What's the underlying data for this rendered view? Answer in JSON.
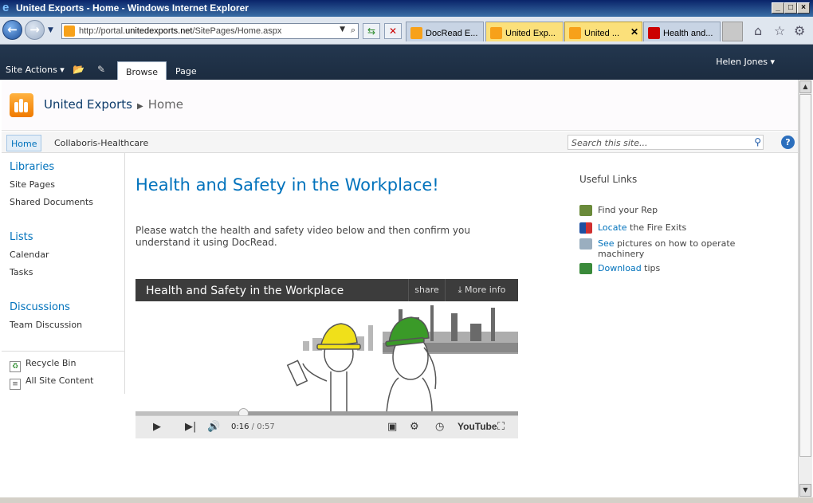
{
  "window": {
    "title": "United Exports - Home - Windows Internet Explorer"
  },
  "address": {
    "url_prefix": "http://portal.",
    "url_domain": "unitedexports.net",
    "url_path": "/SitePages/Home.aspx"
  },
  "tabs": [
    {
      "label": "DocRead E...",
      "color": "#f7a11a"
    },
    {
      "label": "United Exp...",
      "color": "#f7a11a"
    },
    {
      "label": "United ...",
      "color": "#f7a11a"
    },
    {
      "label": "Health and...",
      "color": "#cc0000"
    }
  ],
  "ribbon": {
    "site_actions": "Site Actions",
    "tab_browse": "Browse",
    "tab_page": "Page",
    "user": "Helen Jones"
  },
  "site": {
    "name": "United Exports",
    "page": "Home"
  },
  "topnav": {
    "home": "Home",
    "collaboris": "Collaboris-Healthcare",
    "search_placeholder": "Search this site...",
    "help": "?"
  },
  "leftnav": {
    "libraries": "Libraries",
    "site_pages": "Site Pages",
    "shared_documents": "Shared Documents",
    "lists": "Lists",
    "calendar": "Calendar",
    "tasks": "Tasks",
    "discussions": "Discussions",
    "team_discussion": "Team Discussion",
    "recycle_bin": "Recycle Bin",
    "all_site_content": "All Site Content"
  },
  "main": {
    "title": "Health and Safety in the Workplace!",
    "text": "Please watch the health and safety video below and then confirm you understand it using DocRead."
  },
  "video": {
    "title": "Health and Safety in the Workplace",
    "share": "share",
    "more_info": "More info",
    "current": "0:16",
    "duration": "0:57",
    "progress": 0.2807,
    "logo": "YouTube"
  },
  "useful_links": {
    "title": "Useful Links",
    "items": [
      {
        "link": "",
        "text": "Find your Rep",
        "icon": "people-icon",
        "color": "#6a8a3a"
      },
      {
        "link": "Locate",
        "text": " the Fire Exits",
        "icon": "flag-icon",
        "color": "#1d4fa0"
      },
      {
        "link": "See",
        "text": " pictures on how to operate machinery",
        "icon": "picture-icon",
        "color": "#9aaebf"
      },
      {
        "link": "Download",
        "text": " tips",
        "icon": "document-icon",
        "color": "#3a8a3a"
      }
    ]
  }
}
